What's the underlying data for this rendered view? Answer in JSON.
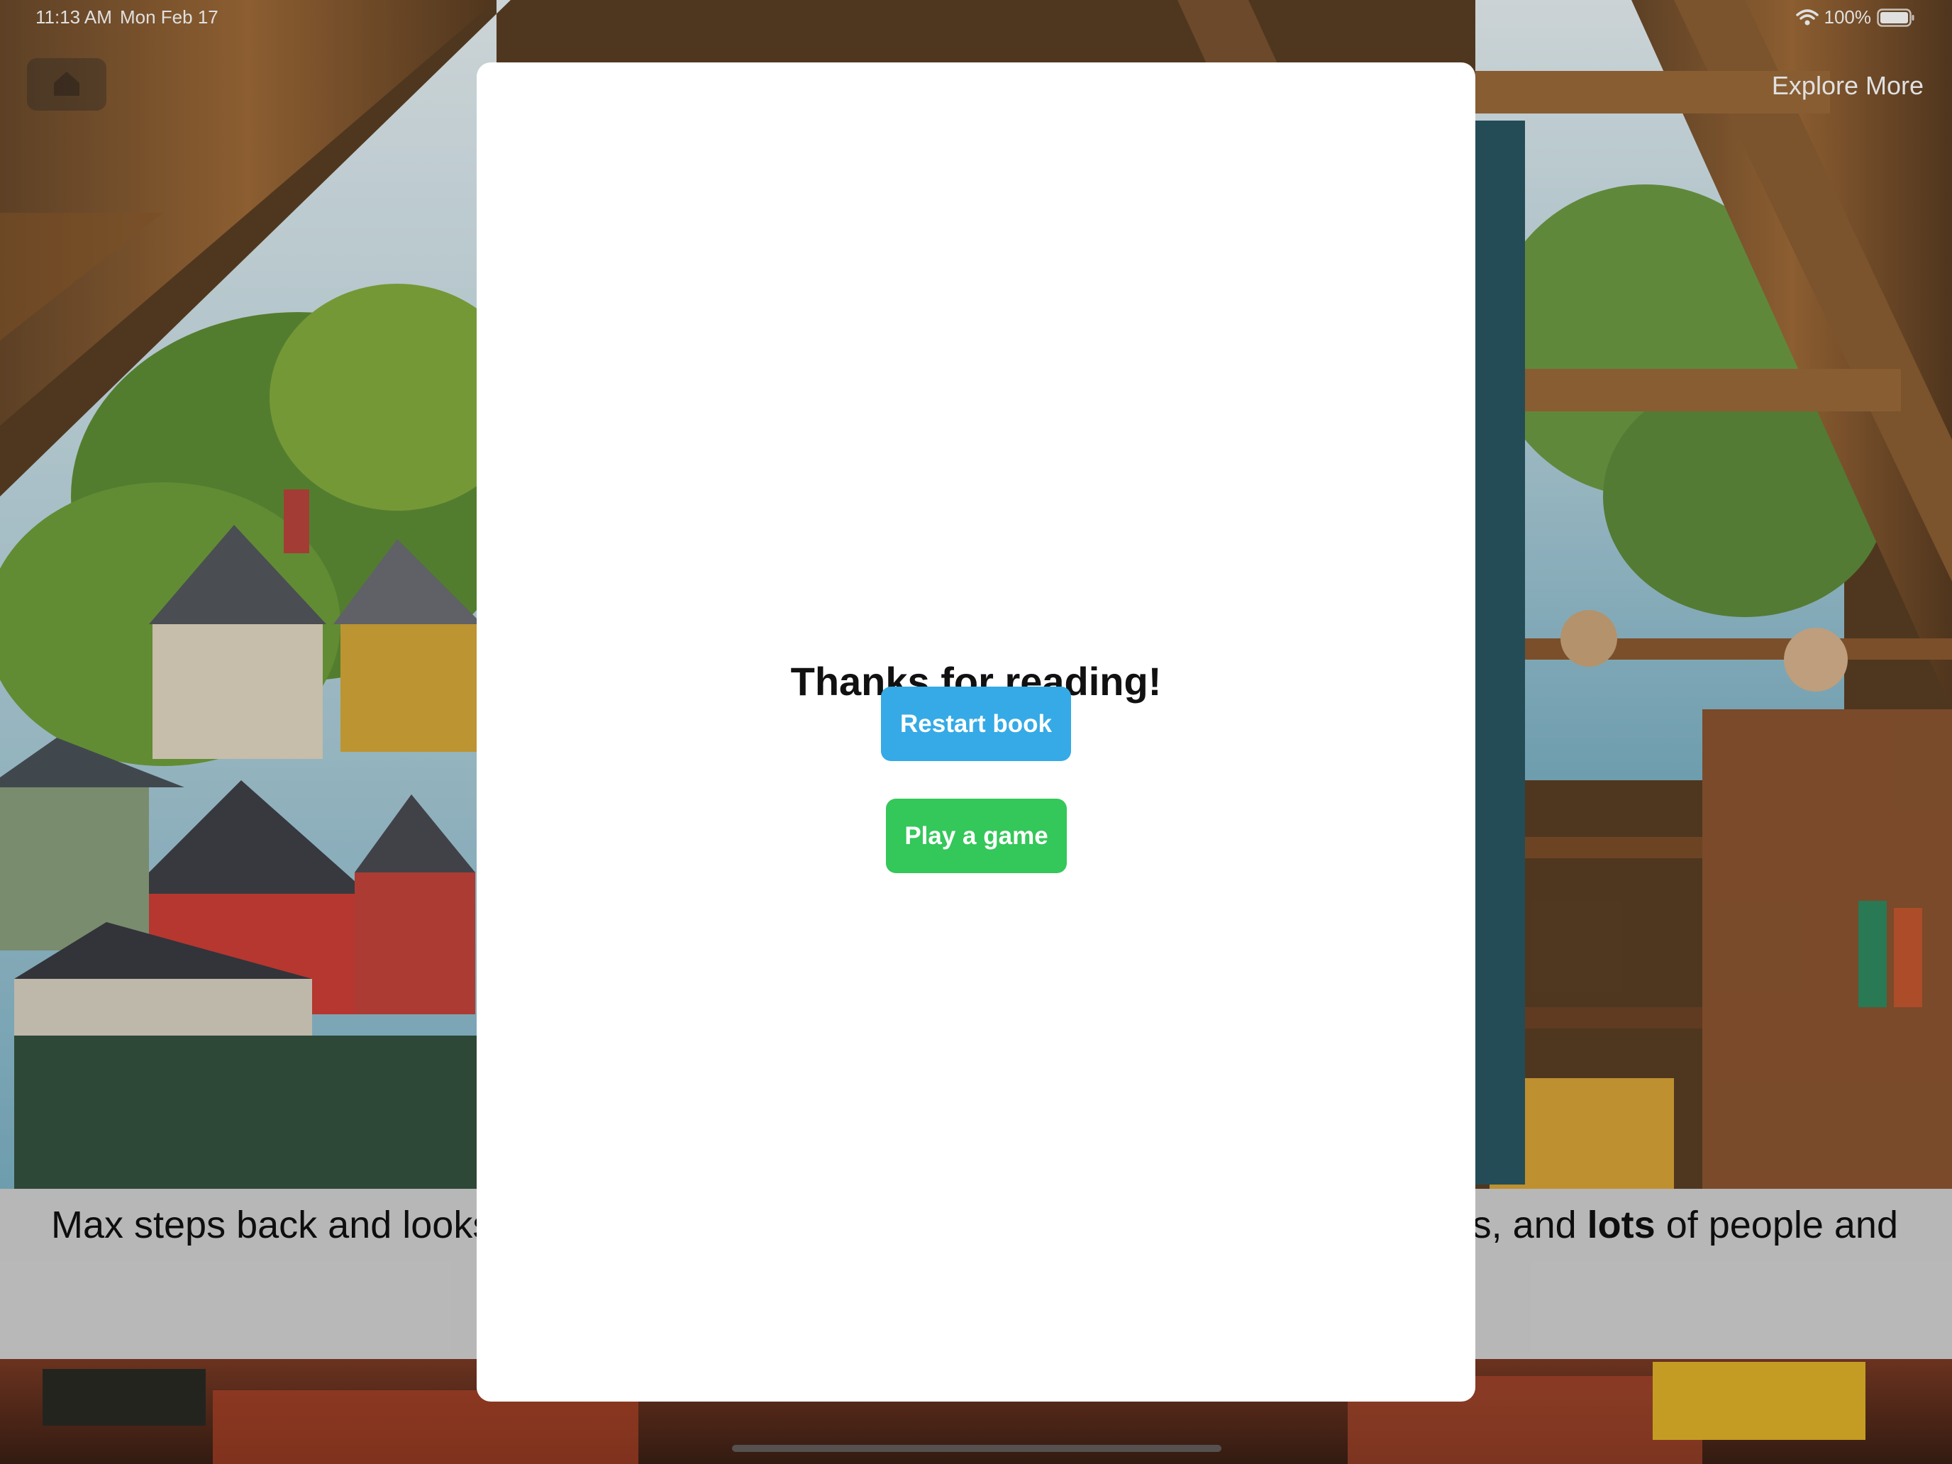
{
  "status_bar": {
    "time": "11:13 AM",
    "date": "Mon Feb 17",
    "battery": "100%",
    "icons": [
      "wifi-icon",
      "battery-icon"
    ]
  },
  "nav": {
    "home_icon": "house-icon",
    "explore_label": "Explore More"
  },
  "caption": {
    "left_text": "Max steps back and looks",
    "right_prefix": "es, and ",
    "right_bold": "lots",
    "right_suffix": " of people and"
  },
  "modal": {
    "title": "Thanks for reading!",
    "restart_label": "Restart book",
    "game_label": "Play a game"
  },
  "colors": {
    "restart_button": "#35aae6",
    "game_button": "#34c759",
    "caption_band": "#d1d1d1"
  }
}
